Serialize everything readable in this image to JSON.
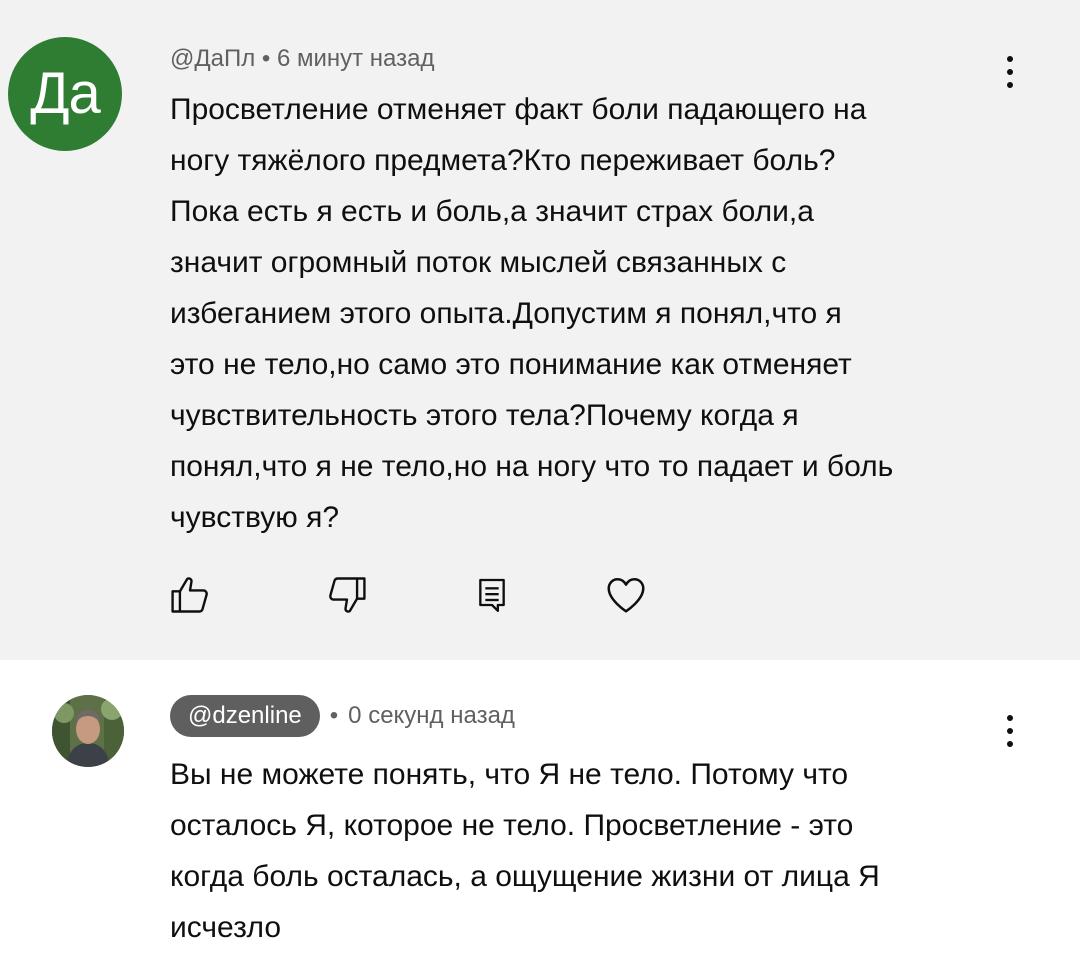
{
  "comments": [
    {
      "avatar_text": "Да",
      "author": "@ДаПл",
      "separator": "•",
      "time": "6 минут назад",
      "meta_line": "@ДаПл • 6 минут назад",
      "text": "Просветление отменяет факт боли падающего на\nногу тяжёлого предмета?Кто переживает боль?\nПока есть я есть и боль,а значит страх боли,а\nзначит огромный поток мыслей связанных с\nизбеганием этого опыта.Допустим я понял,что я\nэто не тело,но само это понимание как отменяет\nчувствительность этого тела?Почему когда я\nпонял,что я не тело,но на ногу что то падает и боль\nчувствую я?",
      "avatar_color": "#2e7d32",
      "actions": [
        "like-icon",
        "dislike-icon",
        "reply-icon",
        "heart-icon"
      ]
    },
    {
      "author": "@dzenline",
      "separator": "•",
      "time": "0 секунд назад",
      "text": "Вы не можете понять, что Я не тело. Потому что\nосталось Я, которое не тело. Просветление - это\nкогда боль осталась, а ощущение жизни от лица Я\nисчезло",
      "author_pill_color": "#5f5f5f"
    }
  ]
}
